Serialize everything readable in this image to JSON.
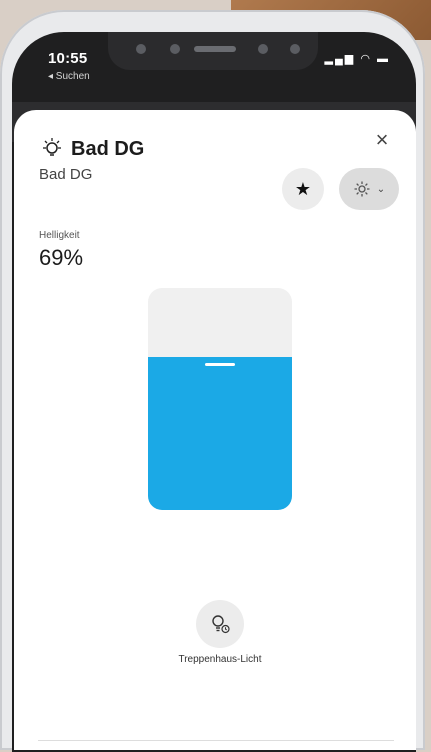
{
  "status_bar": {
    "time": "10:55",
    "back_label": "◂ Suchen"
  },
  "sheet": {
    "title": "Bad DG",
    "subtitle": "Bad DG",
    "close_icon": "close-icon",
    "favorite_icon": "star-icon",
    "settings_icon": "gear-icon"
  },
  "brightness": {
    "label": "Helligkeit",
    "value_text": "69%",
    "value": 0.69,
    "fill_color": "#1ba9e6"
  },
  "staircase": {
    "icon": "bulb-timer-icon",
    "label": "Treppenhaus-Licht"
  }
}
